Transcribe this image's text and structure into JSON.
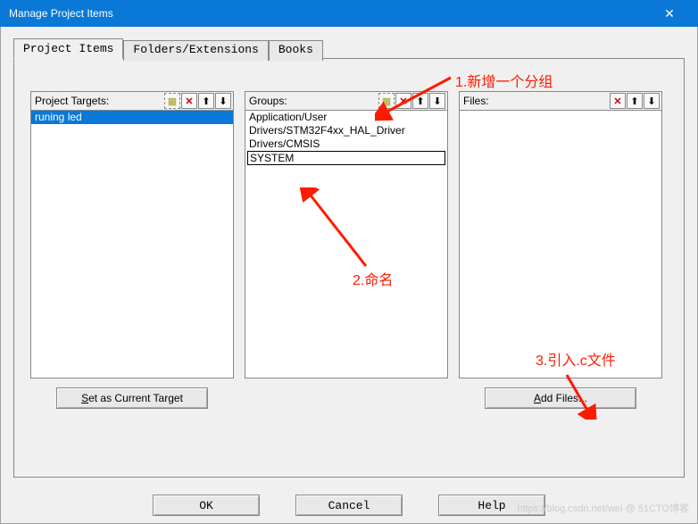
{
  "window": {
    "title": "Manage Project Items"
  },
  "tabs": {
    "items": [
      {
        "label": "Project Items"
      },
      {
        "label": "Folders/Extensions"
      },
      {
        "label": "Books"
      }
    ]
  },
  "targets": {
    "header": "Project Targets:",
    "items": [
      {
        "label": "runing led"
      }
    ],
    "button_label": "Set as Current Target",
    "button_accel": "S"
  },
  "groups": {
    "header": "Groups:",
    "items": [
      {
        "label": "Application/User"
      },
      {
        "label": "Drivers/STM32F4xx_HAL_Driver"
      },
      {
        "label": "Drivers/CMSIS"
      }
    ],
    "editing_value": "SYSTEM"
  },
  "files": {
    "header": "Files:",
    "button_label": "Add Files...",
    "button_accel": "A"
  },
  "buttons": {
    "ok": "OK",
    "cancel": "Cancel",
    "help": "Help"
  },
  "annotations": {
    "a1": "1.新增一个分组",
    "a2": "2.命名",
    "a3": "3.引入.c文件"
  },
  "watermark": "https://blog.csdn.net/wei   @ 51CTO博客"
}
